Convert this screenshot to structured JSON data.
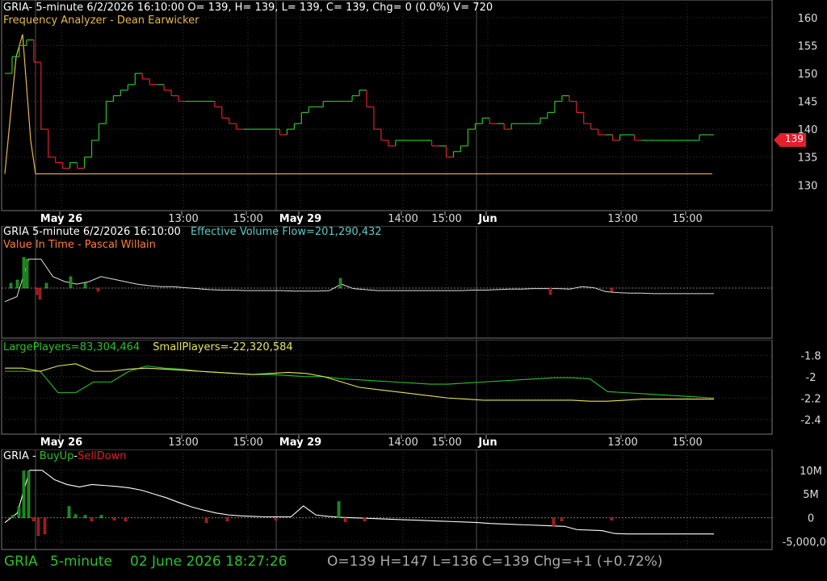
{
  "colors": {
    "up": "#29c22a",
    "down": "#e0202a",
    "grid": "#3a3a3a",
    "gold": "#e8b84a",
    "teal": "#5fc8c8",
    "yellow": "#e6e65a",
    "white": "#ffffff",
    "orange": "#ff7a3c"
  },
  "panel1": {
    "header_line1": "GRIA- 5-minute 6/2/2026 16:10:00 O= 139, H= 139, L= 139, C= 139, Chg= 0 (0.0%) V= 720",
    "header_line2": "Frequency Analyzer - Dean Earwicker",
    "price_tag": "139"
  },
  "panel2": {
    "header_a": "GRIA 5-minute  6/2/2026 16:10:00",
    "header_b": "Effective Volume Flow=201,290,432",
    "header_c": "Value In Time - Pascal Willain"
  },
  "panel3": {
    "header_a": "LargePlayers=83,304,464",
    "header_b": "SmallPlayers=-22,320,584"
  },
  "panel4": {
    "header_a": "GRIA - ",
    "header_b": "BuyUp",
    "header_c": "-",
    "header_d": "SellDown"
  },
  "status": {
    "symbol": "GRIA",
    "interval": "5-minute",
    "datetime": "02 June 2026 18:27:26",
    "ohlc": "O=139  H=147  L=136  C=139  Chg=+1 (+0.72%)"
  },
  "chart_data": [
    {
      "type": "line",
      "name": "price",
      "ylim": [
        127,
        162
      ],
      "yticks": [
        130,
        135,
        140,
        145,
        150,
        155,
        160
      ],
      "x_labels": [
        "May 26",
        "13:00",
        "15:00",
        "May 29",
        "14:00",
        "15:00",
        "Jun",
        "13:00",
        "15:00"
      ],
      "bold_labels": [
        "May 26",
        "May 29",
        "Jun"
      ],
      "values": [
        150,
        153,
        155,
        156,
        152,
        140,
        135,
        134,
        133,
        134,
        133,
        135,
        138,
        141,
        145,
        146,
        147,
        148,
        150,
        149,
        148,
        148,
        147,
        146,
        145,
        145,
        145,
        145,
        145,
        144,
        142,
        141,
        140,
        140,
        140,
        140,
        140,
        140,
        139,
        140,
        141,
        143,
        144,
        144,
        145,
        145,
        145,
        145,
        146,
        147,
        144,
        140,
        138,
        137,
        138,
        138,
        138,
        138,
        138,
        137,
        137,
        135,
        136,
        137,
        140,
        141,
        142,
        141,
        141,
        140,
        141,
        141,
        141,
        141,
        142,
        143,
        145,
        146,
        145,
        143,
        141,
        140,
        139,
        139,
        138,
        139,
        139,
        138,
        138,
        138,
        138,
        138,
        138,
        138,
        138,
        138,
        139,
        139,
        139
      ],
      "freq_line": [
        132,
        153,
        157,
        138,
        132,
        132,
        132,
        132,
        132,
        132
      ]
    },
    {
      "type": "line",
      "name": "effective_volume_flow",
      "values": [
        0.1,
        0.2,
        0.95,
        0.95,
        0.6,
        0.5,
        0.45,
        0.5,
        0.6,
        0.55,
        0.5,
        0.45,
        0.42,
        0.4,
        0.4,
        0.38,
        0.36,
        0.34,
        0.33,
        0.33,
        0.32,
        0.32,
        0.32,
        0.32,
        0.31,
        0.31,
        0.31,
        0.32,
        0.45,
        0.36,
        0.34,
        0.32,
        0.32,
        0.32,
        0.32,
        0.32,
        0.32,
        0.32,
        0.32,
        0.33,
        0.33,
        0.34,
        0.35,
        0.35,
        0.36,
        0.36,
        0.36,
        0.35,
        0.4,
        0.38,
        0.3,
        0.28,
        0.27,
        0.27,
        0.26,
        0.26,
        0.26,
        0.26,
        0.26,
        0.26
      ]
    },
    {
      "type": "line",
      "name": "large_small_players",
      "yticks": [
        -1.8,
        -2,
        -2.2,
        -2.4
      ],
      "ylim": [
        -2.5,
        -1.7
      ],
      "large_values": [
        -1.95,
        -1.95,
        -1.95,
        -2.15,
        -2.15,
        -2.05,
        -2.05,
        -1.95,
        -1.9,
        -1.92,
        -1.93,
        -1.95,
        -1.96,
        -1.97,
        -1.98,
        -1.98,
        -1.99,
        -2.0,
        -2.0,
        -2.02,
        -2.03,
        -2.04,
        -2.05,
        -2.06,
        -2.07,
        -2.07,
        -2.06,
        -2.05,
        -2.04,
        -2.03,
        -2.02,
        -2.01,
        -2.01,
        -2.02,
        -2.14,
        -2.15,
        -2.16,
        -2.17,
        -2.18,
        -2.19,
        -2.2
      ],
      "small_values": [
        -1.92,
        -1.92,
        -1.95,
        -1.9,
        -1.88,
        -1.95,
        -1.95,
        -1.93,
        -1.92,
        -1.93,
        -1.94,
        -1.95,
        -1.96,
        -1.97,
        -1.98,
        -1.97,
        -1.96,
        -1.97,
        -2.0,
        -2.05,
        -2.1,
        -2.12,
        -2.14,
        -2.16,
        -2.18,
        -2.2,
        -2.21,
        -2.22,
        -2.22,
        -2.22,
        -2.22,
        -2.22,
        -2.22,
        -2.23,
        -2.23,
        -2.22,
        -2.21,
        -2.21,
        -2.21,
        -2.21,
        -2.21
      ]
    },
    {
      "type": "bar",
      "name": "buyup_selldown",
      "yticks": [
        "10M",
        "5M",
        "0",
        "-5,000,000"
      ],
      "ylim": [
        -6000000,
        12000000
      ],
      "line_values": [
        -1000000,
        1000000,
        10000000,
        10000000,
        8000000,
        7000000,
        6500000,
        7000000,
        6800000,
        6600000,
        6300000,
        5800000,
        5000000,
        4200000,
        3200000,
        2300000,
        1600000,
        1000000,
        600000,
        400000,
        300000,
        200000,
        200000,
        200000,
        2500000,
        600000,
        300000,
        100000,
        0,
        -100000,
        -200000,
        -300000,
        -400000,
        -500000,
        -600000,
        -700000,
        -800000,
        -900000,
        -1000000,
        -1200000,
        -1300000,
        -1400000,
        -1500000,
        -1600000,
        -1700000,
        -1800000,
        -2500000,
        -2600000,
        -2700000,
        -3300000,
        -3400000,
        -3400000,
        -3400000,
        -3400000,
        -3400000,
        -3400000,
        -3400000,
        -3400000
      ]
    }
  ]
}
